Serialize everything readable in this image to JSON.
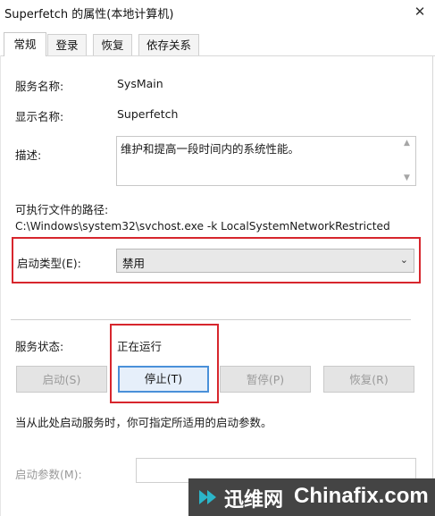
{
  "window": {
    "title": "Superfetch 的属性(本地计算机)",
    "close_glyph": "✕"
  },
  "tabs": [
    {
      "label": "常规",
      "active": true
    },
    {
      "label": "登录",
      "active": false
    },
    {
      "label": "恢复",
      "active": false
    },
    {
      "label": "依存关系",
      "active": false
    }
  ],
  "general": {
    "service_name_label": "服务名称:",
    "service_name_value": "SysMain",
    "display_name_label": "显示名称:",
    "display_name_value": "Superfetch",
    "description_label": "描述:",
    "description_value": "维护和提高一段时间内的系统性能。",
    "exe_path_label": "可执行文件的路径:",
    "exe_path_value": "C:\\Windows\\system32\\svchost.exe -k LocalSystemNetworkRestricted",
    "startup_type_label": "启动类型(E):",
    "startup_type_value": "禁用",
    "service_status_label": "服务状态:",
    "service_status_value": "正在运行",
    "buttons": {
      "start": "启动(S)",
      "stop": "停止(T)",
      "pause": "暂停(P)",
      "resume": "恢复(R)"
    },
    "hint_text": "当从此处启动服务时，你可指定所适用的启动参数。",
    "start_params_label": "启动参数(M):",
    "start_params_value": ""
  },
  "watermark": {
    "cn": "迅维网",
    "en": "Chinafix.com"
  },
  "colors": {
    "highlight": "#d7262d",
    "focus": "#4a90d9",
    "watermark_bg": "#444444",
    "logo": "#2bb5c9"
  }
}
